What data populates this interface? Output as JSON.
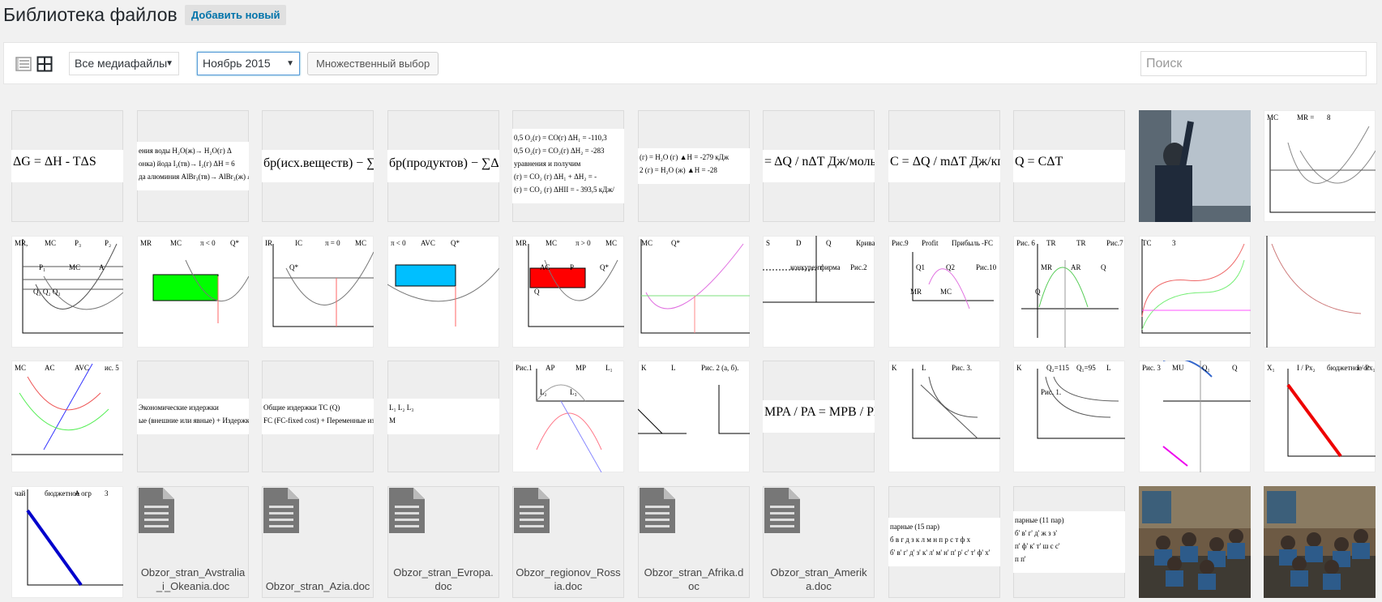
{
  "page": {
    "title": "Библиотека файлов",
    "add_new": "Добавить новый"
  },
  "toolbar": {
    "list_view_icon": "list-view-icon",
    "grid_view_icon": "grid-view-icon",
    "filter_type": {
      "selected": "Все медиафайлы"
    },
    "filter_date": {
      "selected": "Ноябрь 2015"
    },
    "bulk_select": "Множественный выбор",
    "search_placeholder": "Поиск"
  },
  "media": [
    {
      "kind": "formula",
      "text": "ΔG = ΔH - TΔS"
    },
    {
      "kind": "formula",
      "lines": [
        "ения воды      H₂O(ж)→ H₂O(г)      Δ",
        "онка) йода     I₂(тв)→ I₂(г)      ΔH = 6",
        "да алюминия     AlBr₃(тв)→ AlBr₃(ж)  Δ"
      ]
    },
    {
      "kind": "formula",
      "text": "бр(исх.веществ) − ∑ΔH⁰обр"
    },
    {
      "kind": "formula",
      "text": "бр(продуктов) − ∑ΔH⁰обр"
    },
    {
      "kind": "formula",
      "lines": [
        "0,5 O₂(г) = CO(г)     ΔH₁ = -110,3",
        "0,5 O₂(г) =  CO₂(г)    ΔH₂ = -283",
        "уравнения и получим",
        "(г) = CO₂ (г)    ΔH₁ + ΔH₂ = -",
        "(г) = CO₂ (г)    ΔHII = - 393,5 кДж/"
      ]
    },
    {
      "kind": "formula",
      "lines": [
        "(г)  =  H₂O (г)   ▲H = -279 кДж",
        "2 (г)  =   H₂O (ж)   ▲H = -28"
      ]
    },
    {
      "kind": "formula",
      "text": "= ΔQ / nΔT  Дж/моль·"
    },
    {
      "kind": "formula",
      "text": "C = ΔQ / mΔT  Дж/кг·"
    },
    {
      "kind": "formula",
      "text": "Q = CΔT"
    },
    {
      "kind": "photo",
      "subject": "person-at-whiteboard"
    },
    {
      "kind": "chart",
      "labels": [
        "MC",
        "MR =",
        "8"
      ]
    },
    {
      "kind": "chart",
      "labels": [
        "MR,",
        "MC",
        "P₃",
        "P₂",
        "P₁",
        "MC",
        "A",
        "Q₁ Q₂ Q₃"
      ]
    },
    {
      "kind": "chart",
      "labels": [
        "MR",
        "MC",
        "π < 0",
        "Q*"
      ]
    },
    {
      "kind": "chart",
      "labels": [
        "IR",
        "IC",
        "π = 0",
        "MC",
        "Q*"
      ]
    },
    {
      "kind": "chart",
      "labels": [
        "π < 0",
        "AVC",
        "Q*"
      ]
    },
    {
      "kind": "chart",
      "labels": [
        "MR",
        "MC",
        "π > 0",
        "MC",
        "AC",
        "P",
        "Q*",
        "Q"
      ]
    },
    {
      "kind": "chart",
      "labels": [
        "MC",
        "Q*"
      ]
    },
    {
      "kind": "chart",
      "labels": [
        "S",
        "D",
        "Q",
        "Кривая сп",
        "конкурент",
        "фирма",
        "Рис.2"
      ]
    },
    {
      "kind": "chart",
      "labels": [
        "Рис.9",
        "Profit",
        "Прибыль",
        "-FC",
        "Q1",
        "Q2",
        "Рис.10",
        "MR",
        "MC"
      ]
    },
    {
      "kind": "chart",
      "labels": [
        "Рис. 6",
        "TR",
        "TR",
        "Рис.7",
        "MR",
        "AR",
        "Q",
        "Q"
      ]
    },
    {
      "kind": "chart",
      "labels": [
        "TC",
        "3"
      ]
    },
    {
      "kind": "chart",
      "labels": []
    },
    {
      "kind": "chart",
      "labels": [
        "MC",
        "AC",
        "AVC",
        "ис. 5"
      ]
    },
    {
      "kind": "formula",
      "lines": [
        "Экономические издержки",
        "ые (внешние или явные)   +   Издержки"
      ]
    },
    {
      "kind": "formula",
      "lines": [
        "Общие издержки TC (Q)",
        "FC (FC-fixed cost)  +  Переменные издерж"
      ]
    },
    {
      "kind": "formula",
      "lines": [
        "L₁   L₂   L₃",
        "M"
      ]
    },
    {
      "kind": "chart",
      "labels": [
        "Рис.1",
        "AP",
        "MP",
        "L₁",
        "L₂",
        "L₃"
      ]
    },
    {
      "kind": "chart",
      "labels": [
        "K",
        "L",
        "Рис. 2 (а, б)."
      ]
    },
    {
      "kind": "formula",
      "text": "MPA / PA = MPB / PB ."
    },
    {
      "kind": "chart",
      "labels": [
        "K",
        "L",
        "Рис. 3."
      ]
    },
    {
      "kind": "chart",
      "labels": [
        "K",
        "Q₂=115",
        "Q₁=95",
        "L",
        "Рис. 1."
      ]
    },
    {
      "kind": "chart",
      "labels": [
        "Рис. 3",
        "MU",
        "Q₁",
        "Q"
      ]
    },
    {
      "kind": "chart",
      "labels": [
        "X₁",
        "I / Px₂",
        "бюджетное ог",
        "I / Px₁"
      ]
    },
    {
      "kind": "chart",
      "labels": [
        "чай",
        "бюджетное огр",
        "A",
        "3"
      ]
    },
    {
      "kind": "document",
      "filename": "Obzor_stran_Avstralia_i_Okeania.doc"
    },
    {
      "kind": "document",
      "filename": "Obzor_stran_Azia.doc"
    },
    {
      "kind": "document",
      "filename": "Obzor_stran_Evropa.doc"
    },
    {
      "kind": "document",
      "filename": "Obzor_regionov_Rossia.doc"
    },
    {
      "kind": "document",
      "filename": "Obzor_stran_Afrika.doc"
    },
    {
      "kind": "document",
      "filename": "Obzor_stran_Amerika.doc"
    },
    {
      "kind": "formula",
      "lines": [
        "парные (15 пар)",
        "б в г д з к л м н п р с т ф х",
        "б' в' г' д' з' к' л' м' н' п' р' с' т' ф' х'"
      ]
    },
    {
      "kind": "formula",
      "lines": [
        "парные (11 пар)",
        "б' в' г' д' ж з з'",
        "п' ф' к' т' ш с с'",
        "п п'"
      ]
    },
    {
      "kind": "photo",
      "subject": "classroom-microscopes"
    },
    {
      "kind": "photo",
      "subject": "classroom-students"
    }
  ]
}
